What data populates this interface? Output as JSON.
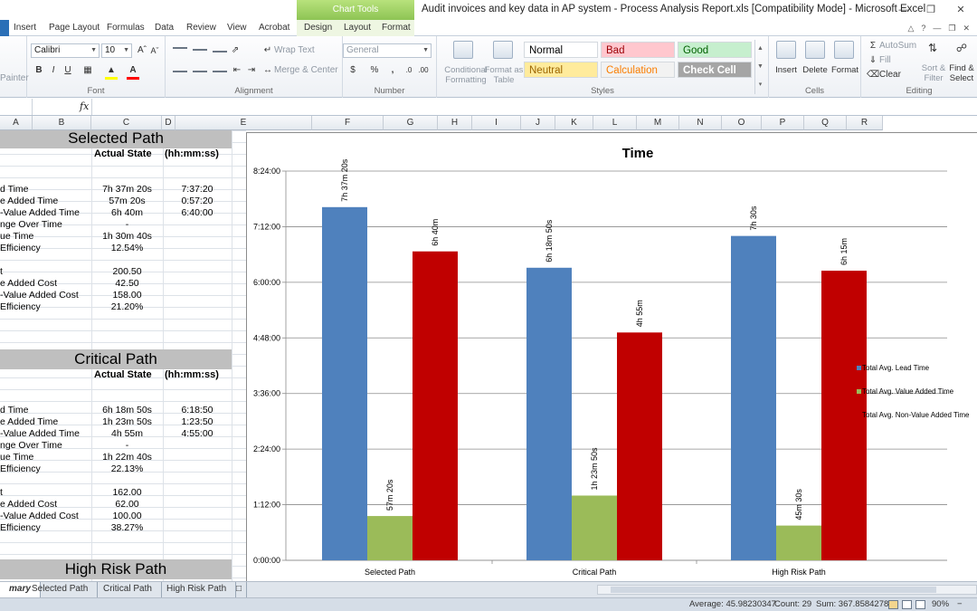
{
  "window": {
    "title": "Audit invoices and key data in AP system - Process Analysis Report.xls  [Compatibility Mode]  -  Microsoft Excel",
    "context_tab_group": "Chart Tools"
  },
  "tabs": [
    "Insert",
    "Page Layout",
    "Formulas",
    "Data",
    "Review",
    "View",
    "Acrobat",
    "Design",
    "Layout",
    "Format"
  ],
  "ribbon": {
    "clipboard": {
      "format_painter": "Painter"
    },
    "font": {
      "name": "Calibri",
      "size": "10",
      "label": "Font",
      "bold": "B",
      "italic": "I",
      "underline": "U"
    },
    "alignment": {
      "wrap_text": "Wrap Text",
      "merge_center": "Merge & Center",
      "label": "Alignment"
    },
    "number": {
      "format": "General",
      "currency": "$",
      "percent": "%",
      "comma": ",",
      "label": "Number"
    },
    "styles": {
      "conditional": "Conditional\nFormatting",
      "format_table": "Format as\nTable",
      "cells": [
        {
          "label": "Normal",
          "bg": "#ffffff",
          "fg": "#000000"
        },
        {
          "label": "Bad",
          "bg": "#ffc7ce",
          "fg": "#9c0006"
        },
        {
          "label": "Good",
          "bg": "#c6efce",
          "fg": "#006100"
        },
        {
          "label": "Neutral",
          "bg": "#ffeb9c",
          "fg": "#9c6500"
        },
        {
          "label": "Calculation",
          "bg": "#f2f2f2",
          "fg": "#fa7d00"
        },
        {
          "label": "Check Cell",
          "bg": "#a5a5a5",
          "fg": "#ffffff"
        }
      ],
      "label": "Styles"
    },
    "cells": {
      "insert": "Insert",
      "delete": "Delete",
      "format": "Format",
      "label": "Cells"
    },
    "editing": {
      "autosum": "AutoSum",
      "fill": "Fill",
      "clear": "Clear",
      "sort": "Sort &\nFilter",
      "find": "Find &\nSelect",
      "label": "Editing"
    }
  },
  "formula_bar": {
    "fx": "fx"
  },
  "columns": [
    "A",
    "B",
    "C",
    "D",
    "E",
    "F",
    "G",
    "H",
    "I",
    "J",
    "K",
    "L",
    "M",
    "N",
    "O",
    "P",
    "Q",
    "R"
  ],
  "sheet": {
    "sections": [
      {
        "title": "Selected Path",
        "col_b_header": "Actual State",
        "col_c_header": "(hh:mm:ss)",
        "rows": [
          {
            "label": "d Time",
            "b": "7h 37m 20s",
            "c": "7:37:20"
          },
          {
            "label": "e Added Time",
            "b": "57m 20s",
            "c": "0:57:20"
          },
          {
            "label": "-Value Added Time",
            "b": "6h 40m",
            "c": "6:40:00"
          },
          {
            "label": "nge Over Time",
            "b": "-",
            "c": ""
          },
          {
            "label": "ue Time",
            "b": "1h 30m 40s",
            "c": ""
          },
          {
            "label": " Efficiency",
            "b": "12.54%",
            "c": ""
          },
          {
            "label": "",
            "b": "",
            "c": ""
          },
          {
            "label": "t",
            "b": "200.50",
            "c": ""
          },
          {
            "label": "e Added Cost",
            "b": "42.50",
            "c": ""
          },
          {
            "label": "-Value Added Cost",
            "b": "158.00",
            "c": ""
          },
          {
            "label": "Efficiency",
            "b": "21.20%",
            "c": ""
          }
        ]
      },
      {
        "title": "Critical Path",
        "col_b_header": "Actual State",
        "col_c_header": "(hh:mm:ss)",
        "rows": [
          {
            "label": "d Time",
            "b": "6h 18m 50s",
            "c": "6:18:50"
          },
          {
            "label": "e Added Time",
            "b": "1h 23m 50s",
            "c": "1:23:50"
          },
          {
            "label": "-Value Added Time",
            "b": "4h 55m",
            "c": "4:55:00"
          },
          {
            "label": "nge Over Time",
            "b": "-",
            "c": ""
          },
          {
            "label": "ue Time",
            "b": "1h 22m 40s",
            "c": ""
          },
          {
            "label": " Efficiency",
            "b": "22.13%",
            "c": ""
          },
          {
            "label": "",
            "b": "",
            "c": ""
          },
          {
            "label": "t",
            "b": "162.00",
            "c": ""
          },
          {
            "label": "e Added Cost",
            "b": "62.00",
            "c": ""
          },
          {
            "label": "-Value Added Cost",
            "b": "100.00",
            "c": ""
          },
          {
            "label": "Efficiency",
            "b": "38.27%",
            "c": ""
          }
        ]
      },
      {
        "title": "High Risk Path",
        "col_b_header": "",
        "col_c_header": "",
        "rows": []
      }
    ]
  },
  "sheet_tabs": [
    "mary",
    "Selected Path",
    "Critical Path",
    "High Risk Path"
  ],
  "status": {
    "average": "Average: 45.98230347",
    "count": "Count: 29",
    "sum": "Sum: 367.8584278",
    "zoom": "90%"
  },
  "chart_data": {
    "type": "bar",
    "title": "Time",
    "categories": [
      "Selected Path",
      "Critical Path",
      "High Risk Path"
    ],
    "series": [
      {
        "name": "Total Avg. Lead Time",
        "color": "#4f81bd",
        "values": [
          7.6222,
          6.3139,
          7.0
        ],
        "labels": [
          "7h 37m 20s",
          "6h 18m 50s",
          "7h 30s"
        ]
      },
      {
        "name": "Total Avg. Value Added Time",
        "color": "#9bbb59",
        "values": [
          0.9556,
          1.3972,
          0.75
        ],
        "labels": [
          "57m 20s",
          "1h 23m 50s",
          "45m 30s"
        ]
      },
      {
        "name": "Total Avg. Non-Value Added Time",
        "color": "#c00000",
        "values": [
          6.6667,
          4.9167,
          6.25
        ],
        "labels": [
          "6h 40m",
          "4h 55m",
          "6h 15m"
        ]
      }
    ],
    "y_ticks": [
      "0:00:00",
      "1:12:00",
      "2:24:00",
      "3:36:00",
      "4:48:00",
      "6:00:00",
      "7:12:00",
      "8:24:00"
    ],
    "ylim": [
      0,
      8.4
    ],
    "grid": true,
    "legend": "right"
  }
}
